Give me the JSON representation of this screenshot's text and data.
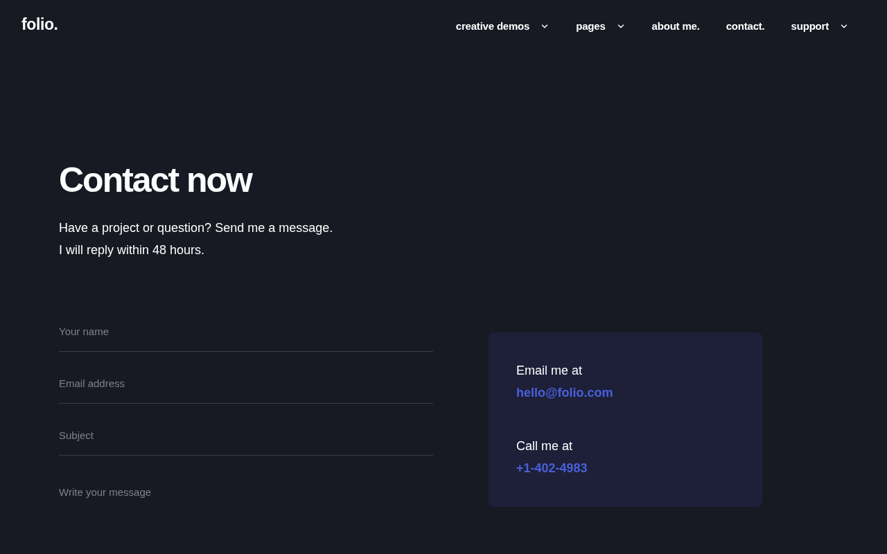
{
  "header": {
    "logo": "folio.",
    "nav": [
      {
        "label": "creative demos",
        "kind": "dropdown"
      },
      {
        "label": "pages",
        "kind": "dropdown"
      },
      {
        "label": "about me.",
        "kind": "link"
      },
      {
        "label": "contact.",
        "kind": "link"
      },
      {
        "label": "support",
        "kind": "dropdown"
      }
    ]
  },
  "hero": {
    "title": "Contact now",
    "lines": [
      "Have a project or question? Send me a message.",
      "I will reply within 48 hours."
    ]
  },
  "form": {
    "fields": [
      {
        "kind": "input",
        "placeholder": "Your name"
      },
      {
        "kind": "input",
        "placeholder": "Email address"
      },
      {
        "kind": "input",
        "placeholder": "Subject"
      },
      {
        "kind": "textarea",
        "placeholder": "Write your message"
      }
    ]
  },
  "contact_card": {
    "items": [
      {
        "label": "Email me at",
        "value": "hello@folio.com"
      },
      {
        "label": "Call me at",
        "value": "+1-402-4983"
      }
    ]
  }
}
